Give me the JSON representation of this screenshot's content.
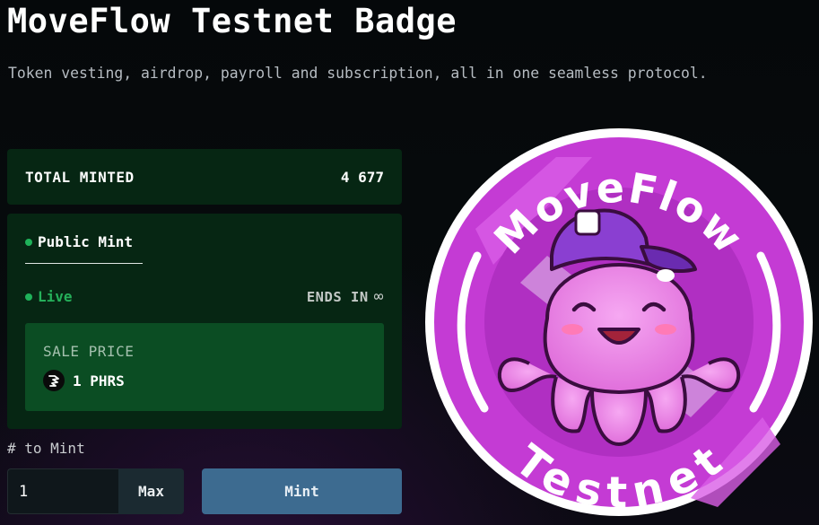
{
  "page": {
    "title": "MoveFlow Testnet Badge",
    "subtitle": "Token vesting, airdrop, payroll and subscription, all in one seamless protocol."
  },
  "minted": {
    "label": "TOTAL MINTED",
    "value": "4 677"
  },
  "sale": {
    "phase_label": "Public Mint",
    "status": "Live",
    "ends_label": "ENDS IN",
    "ends_value": "∞",
    "price_label": "SALE PRICE",
    "price_value": "1 PHRS",
    "token_icon": "phrs-token-icon"
  },
  "mint_form": {
    "quantity_label": "# to Mint",
    "quantity_value": "1",
    "max_label": "Max",
    "mint_label": "Mint"
  },
  "badge": {
    "top_text": "MoveFlow",
    "bottom_text": "Testnet",
    "icon": "octopus-mascot-with-cap"
  },
  "colors": {
    "card_bg": "#062613",
    "price_bg": "#0b4d23",
    "live_green": "#25b05a",
    "mint_button": "#3d6b90",
    "badge_magenta": "#c93fd6"
  }
}
